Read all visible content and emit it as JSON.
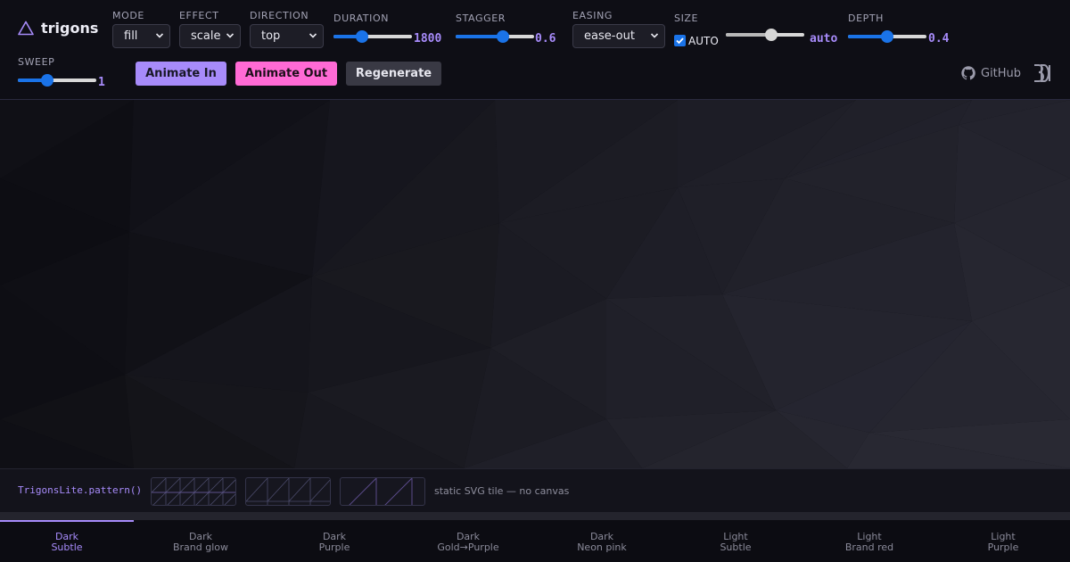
{
  "brand": {
    "name": "trigons"
  },
  "controls": {
    "mode": {
      "label": "MODE",
      "value": "fill"
    },
    "effect": {
      "label": "EFFECT",
      "value": "scale"
    },
    "direction": {
      "label": "DIRECTION",
      "value": "top"
    },
    "duration": {
      "label": "DURATION",
      "value": "1800",
      "fraction": 0.36
    },
    "stagger": {
      "label": "STAGGER",
      "value": "0.6",
      "fraction": 0.6
    },
    "easing": {
      "label": "EASING",
      "value": "ease-out"
    },
    "size": {
      "label": "SIZE",
      "auto_label": "AUTO",
      "auto_checked": true,
      "value": "auto",
      "fraction": 0.58
    },
    "depth": {
      "label": "DEPTH",
      "value": "0.4",
      "fraction": 0.5
    },
    "sweep": {
      "label": "SWEEP",
      "value": "1",
      "fraction": 0.38
    }
  },
  "buttons": {
    "animate_in": "Animate In",
    "animate_out": "Animate Out",
    "regenerate": "Regenerate"
  },
  "links": {
    "github": "GitHub"
  },
  "pattern_strip": {
    "code": "TrigonsLite.pattern()",
    "note": "static SVG tile — no canvas"
  },
  "themes": [
    {
      "line1": "Dark",
      "line2": "Subtle",
      "active": true
    },
    {
      "line1": "Dark",
      "line2": "Brand glow",
      "active": false
    },
    {
      "line1": "Dark",
      "line2": "Purple",
      "active": false
    },
    {
      "line1": "Dark",
      "line2": "Gold→Purple",
      "active": false
    },
    {
      "line1": "Dark",
      "line2": "Neon pink",
      "active": false
    },
    {
      "line1": "Light",
      "line2": "Subtle",
      "active": false
    },
    {
      "line1": "Light",
      "line2": "Brand red",
      "active": false
    },
    {
      "line1": "Light",
      "line2": "Purple",
      "active": false
    }
  ],
  "colors": {
    "accent": "#a78bfa",
    "pink": "#ff6ad5",
    "slider": "#1a73e8",
    "background": "#0f0f14"
  }
}
